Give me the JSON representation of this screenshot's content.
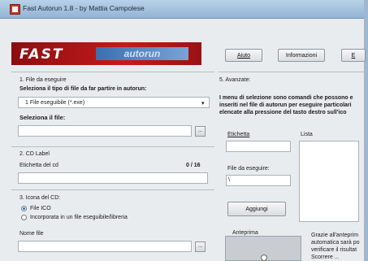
{
  "window": {
    "title": "Fast Autorun 1.8 - by Mattia Campolese"
  },
  "banner": {
    "word1": "FAST",
    "word2": "autorun"
  },
  "toolbar": {
    "aiuto": "Aiuto",
    "informazioni": "Informazioni",
    "third": "E"
  },
  "section1": {
    "header": "1. File da eseguire",
    "prompt": "Seleziona il tipo di file da far partire in autorun:",
    "type_value": "1 File eseguibile (*.exe)",
    "select_label": "Seleziona il file:",
    "browse": "..."
  },
  "section2": {
    "header": "2. CD Label",
    "label": "Etichetta del cd",
    "counter": "0 / 16"
  },
  "section3": {
    "header": "3. Icona del CD:",
    "option1": "File ICO",
    "option2": "Incorporata in un file eseguibile/libreria",
    "name_label": "Nome file",
    "browse": "..."
  },
  "section5": {
    "header": "5. Avanzate:",
    "description": [
      "I menu di selezione sono comandi che possono e",
      "inseriti nel file di autorun per eseguire particolari",
      "elencate alla pressione del tasto destro sull'ico"
    ],
    "etichetta_label": "Etichetta",
    "lista_label": "Lista",
    "file_label": "File da eseguire:",
    "file_value": "\\",
    "add_button": "Aggiungi",
    "anteprima_label": "Anteprima",
    "note": [
      "Grazie all'anteprim",
      "automatica sarà po",
      "verificare il risultat",
      "Scorrere ..."
    ]
  }
}
